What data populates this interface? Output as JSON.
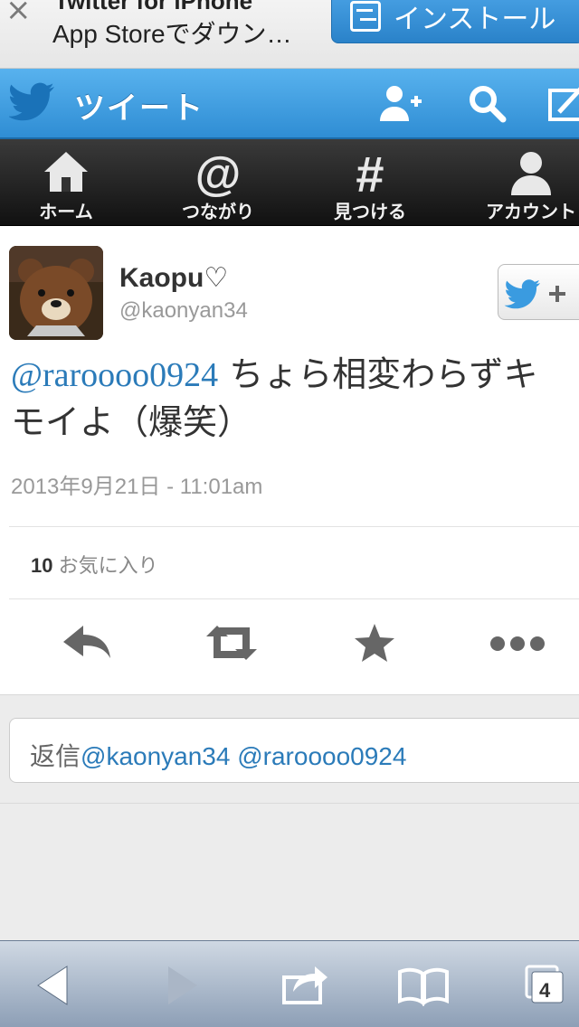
{
  "banner": {
    "close_glyph": "×",
    "title": "Twitter for iPhone",
    "subtitle": "App Storeでダウン…",
    "install_label": "インストール"
  },
  "header": {
    "title": "ツイート",
    "icons": [
      "twitter-bird-icon",
      "add-user-icon",
      "search-icon",
      "compose-icon"
    ]
  },
  "nav": {
    "items": [
      {
        "label": "ホーム",
        "icon": "home-icon"
      },
      {
        "label": "つながり",
        "icon": "at-icon"
      },
      {
        "label": "見つける",
        "icon": "hash-icon"
      },
      {
        "label": "アカウント",
        "icon": "person-icon"
      }
    ]
  },
  "tweet": {
    "user_name": "Kaopu♡",
    "user_handle": "@kaonyan34",
    "mention": "@raroooo0924",
    "text": " ちょら相変わらずキモイよ（爆笑）",
    "timestamp": "2013年9月21日 - 11:01am",
    "favorites_count": "10",
    "favorites_label": " お気に入り"
  },
  "actions": [
    "reply-icon",
    "retweet-icon",
    "favorite-icon",
    "more-icon"
  ],
  "reply": {
    "prefix": "返信",
    "mentions": "@kaonyan34 @raroooo0924"
  },
  "toolbar": {
    "tabs_count": "4",
    "icons": [
      "back-icon",
      "forward-icon",
      "share-icon",
      "bookmarks-icon",
      "tabs-icon"
    ]
  },
  "colors": {
    "header_blue": "#3d9ce2",
    "link_blue": "#2b7bb9",
    "nav_dark": "#1e1e1e"
  }
}
